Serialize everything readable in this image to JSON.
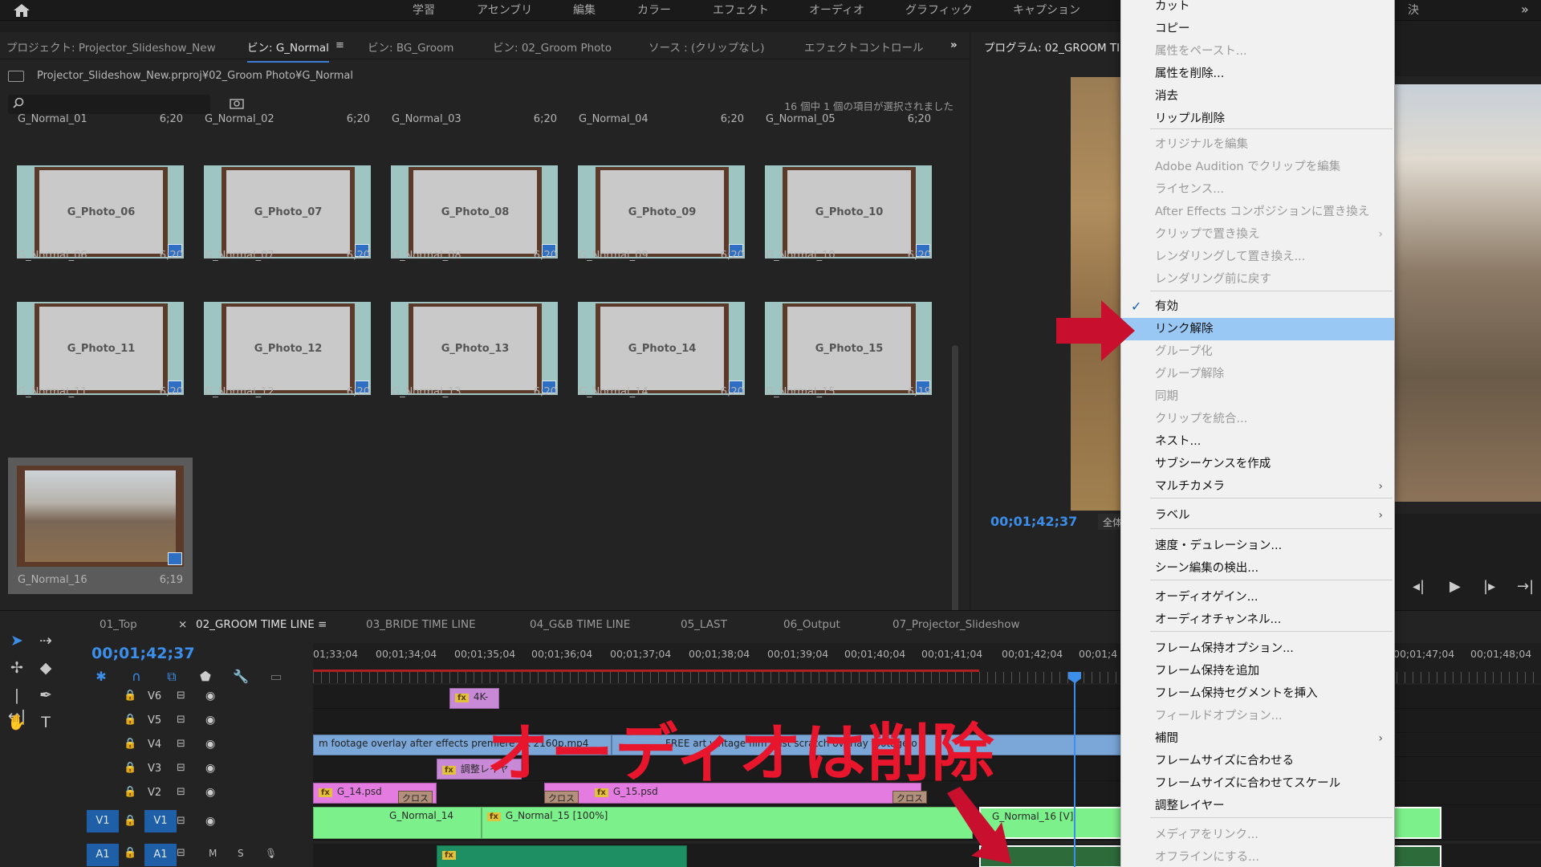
{
  "workspaces": [
    "学習",
    "アセンブリ",
    "編集",
    "カラー",
    "エフェクト",
    "オーディオ",
    "グラフィック",
    "キャプション"
  ],
  "top_right_fragment": "決",
  "project_panel": {
    "tabs": [
      "プロジェクト: Projector_Slideshow_New",
      "ビン: G_Normal",
      "ビン: BG_Groom",
      "ビン: 02_Groom Photo",
      "ソース : (クリップなし)",
      "エフェクトコントロール"
    ],
    "more": "»",
    "path": "Projector_Slideshow_New.prproj¥02_Groom Photo¥G_Normal",
    "selection_status": "16 個中 1 個の項目が選択されました",
    "items": [
      {
        "name": "G_Normal_01",
        "dur": "6;20"
      },
      {
        "name": "G_Normal_02",
        "dur": "6;20"
      },
      {
        "name": "G_Normal_03",
        "dur": "6;20"
      },
      {
        "name": "G_Normal_04",
        "dur": "6;20"
      },
      {
        "name": "G_Normal_05",
        "dur": "6;20"
      },
      {
        "name": "G_Normal_06",
        "dur": "6;20",
        "thumb": "G_Photo_06"
      },
      {
        "name": "G_Normal_07",
        "dur": "6;20",
        "thumb": "G_Photo_07"
      },
      {
        "name": "G_Normal_08",
        "dur": "6;20",
        "thumb": "G_Photo_08"
      },
      {
        "name": "G_Normal_09",
        "dur": "6;20",
        "thumb": "G_Photo_09"
      },
      {
        "name": "G_Normal_10",
        "dur": "6;20",
        "thumb": "G_Photo_10"
      },
      {
        "name": "G_Normal_11",
        "dur": "6;20",
        "thumb": "G_Photo_11"
      },
      {
        "name": "G_Normal_12",
        "dur": "6;20",
        "thumb": "G_Photo_12"
      },
      {
        "name": "G_Normal_13",
        "dur": "6;20",
        "thumb": "G_Photo_13"
      },
      {
        "name": "G_Normal_14",
        "dur": "6;20",
        "thumb": "G_Photo_14"
      },
      {
        "name": "G_Normal_15",
        "dur": "6;19",
        "thumb": "G_Photo_15"
      },
      {
        "name": "G_Normal_16",
        "dur": "6;19"
      }
    ]
  },
  "program_monitor": {
    "tab": "プログラム: 02_GROOM TIM",
    "timecode": "00;01;42;37",
    "fit": "全体"
  },
  "timeline": {
    "tabs": [
      "01_Top",
      "02_GROOM TIME LINE",
      "03_BRIDE TIME LINE",
      "04_G&B TIME LINE",
      "05_LAST",
      "06_Output",
      "07_Projector_Slideshow"
    ],
    "close_glyph": "×",
    "timecode": "00;01;42;37",
    "ruler": [
      "01;33;04",
      "00;01;34;04",
      "00;01;35;04",
      "00;01;36;04",
      "00;01;37;04",
      "00;01;38;04",
      "00;01;39;04",
      "00;01;40;04",
      "00;01;41;04",
      "00;01;42;04",
      "00;01;4",
      "00;01;47;04",
      "00;01;48;04"
    ],
    "tracks": [
      "V6",
      "V5",
      "V4",
      "V3",
      "V2",
      "V1",
      "A1"
    ],
    "target_labels": {
      "v1": "V1",
      "a1": "A1"
    },
    "audio_flags": {
      "m": "M",
      "s": "S"
    },
    "clips": {
      "fourk": "4K-",
      "v4_text": "m footage overlay after effects premiere 4K 2160p.mp4",
      "v4_text2": "FREE art vintage film dust scratch overlay footage o",
      "adjust": "調整レイヤ",
      "g14psd": "G_14.psd",
      "g15psd": "G_15.psd",
      "cross": "クロス",
      "v1_a": "G_Normal_14",
      "v1_b": "G_Normal_15 [100%]",
      "v1_c": "G_Normal_16 [V]"
    }
  },
  "overlay_text": "オーディオは削除",
  "context_menu": {
    "items": [
      {
        "label": "カット",
        "enabled": true
      },
      {
        "label": "コピー",
        "enabled": true
      },
      {
        "label": "属性をペースト...",
        "enabled": false
      },
      {
        "label": "属性を削除...",
        "enabled": true
      },
      {
        "label": "消去",
        "enabled": true
      },
      {
        "label": "リップル削除",
        "enabled": true
      },
      {
        "label": "オリジナルを編集",
        "enabled": false
      },
      {
        "label": "Adobe Audition でクリップを編集",
        "enabled": false
      },
      {
        "label": "ライセンス...",
        "enabled": false
      },
      {
        "label": "After Effects コンポジションに置き換え",
        "enabled": false
      },
      {
        "label": "クリップで置き換え",
        "enabled": false,
        "submenu": true
      },
      {
        "label": "レンダリングして置き換え...",
        "enabled": false
      },
      {
        "label": "レンダリング前に戻す",
        "enabled": false
      },
      {
        "label": "有効",
        "enabled": true,
        "checked": true
      },
      {
        "label": "リンク解除",
        "enabled": true,
        "highlighted": true
      },
      {
        "label": "グループ化",
        "enabled": false
      },
      {
        "label": "グループ解除",
        "enabled": false
      },
      {
        "label": "同期",
        "enabled": false
      },
      {
        "label": "クリップを統合...",
        "enabled": false
      },
      {
        "label": "ネスト...",
        "enabled": true
      },
      {
        "label": "サブシーケンスを作成",
        "enabled": true
      },
      {
        "label": "マルチカメラ",
        "enabled": true,
        "submenu": true
      },
      {
        "label": "ラベル",
        "enabled": true,
        "submenu": true
      },
      {
        "label": "速度・デュレーション...",
        "enabled": true
      },
      {
        "label": "シーン編集の検出...",
        "enabled": true
      },
      {
        "label": "オーディオゲイン...",
        "enabled": true
      },
      {
        "label": "オーディオチャンネル...",
        "enabled": true
      },
      {
        "label": "フレーム保持オプション...",
        "enabled": true
      },
      {
        "label": "フレーム保持を追加",
        "enabled": true
      },
      {
        "label": "フレーム保持セグメントを挿入",
        "enabled": true
      },
      {
        "label": "フィールドオプション...",
        "enabled": false
      },
      {
        "label": "補間",
        "enabled": true,
        "submenu": true
      },
      {
        "label": "フレームサイズに合わせる",
        "enabled": true
      },
      {
        "label": "フレームサイズに合わせてスケール",
        "enabled": true
      },
      {
        "label": "調整レイヤー",
        "enabled": true
      },
      {
        "label": "メディアをリンク...",
        "enabled": false
      },
      {
        "label": "オフラインにする...",
        "enabled": false
      }
    ],
    "submenu_glyph": "›",
    "check_glyph": "✓"
  },
  "colors": {
    "accent_blue": "#3b8eea",
    "highlight": "#99c8f5",
    "arrow_red": "#c8102e",
    "overlay_red": "#e8162c"
  }
}
